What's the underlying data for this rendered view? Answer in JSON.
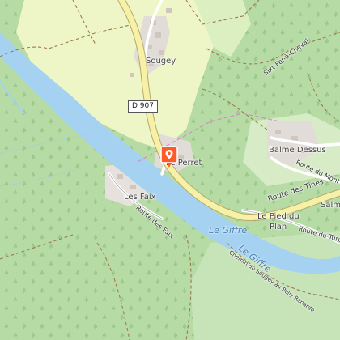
{
  "map": {
    "places": {
      "sougey": "Sougey",
      "le_perret": "Le Perret",
      "balme_dessus": "Balme Dessus",
      "les_faix": "Les Faix",
      "le_pied_du_plan_line1": "Le Pied du",
      "le_pied_du_plan_line2": "Plan",
      "salm": "Salm"
    },
    "water": {
      "river_1": "Le Giffre",
      "river_2": "Le Giffre"
    },
    "roads": {
      "route_des_tines": "Route des Tines",
      "route_des_faix": "Route des Faix",
      "route_du_mont": "Route du Mont",
      "route_du_turu": "Route du Turu",
      "chemin_du_sougey": "Chemin du Sougey au Pelly Renarde",
      "sixt_fer_a_cheval": "Sixt-Fer-à-Cheval"
    },
    "shield": "D 907",
    "colors": {
      "meadow": "#cfe8c3",
      "forest": "#b6dba5",
      "open_field": "#eef6c7",
      "river": "#a6d2f2",
      "main_road": "#f6f1a6",
      "built_area": "#e1dcd7",
      "marker": "#ff5a2a"
    },
    "marker_icon": "map-pin-icon"
  }
}
